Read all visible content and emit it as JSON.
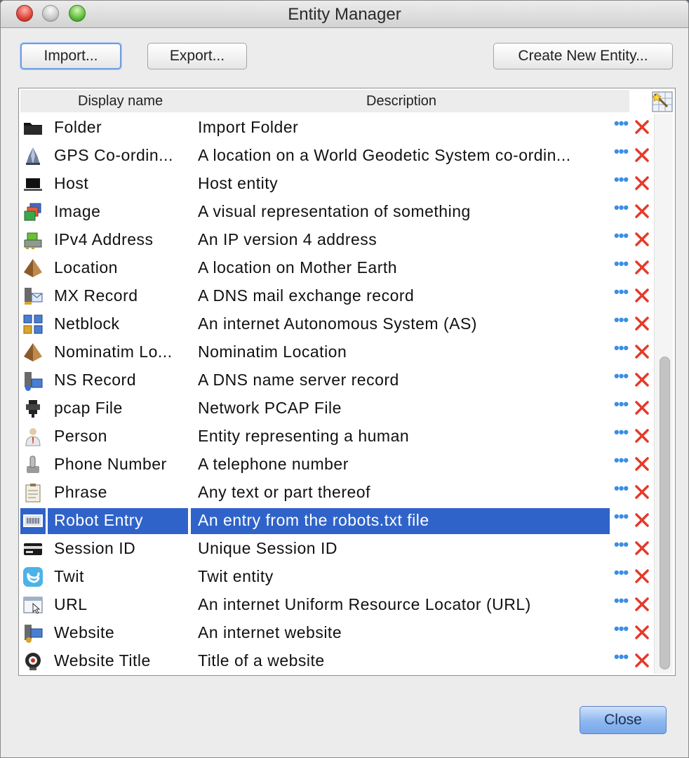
{
  "window": {
    "title": "Entity Manager"
  },
  "toolbar": {
    "import_label": "Import...",
    "export_label": "Export...",
    "create_label": "Create New Entity..."
  },
  "table": {
    "columns": [
      "Display name",
      "Description"
    ],
    "selected_row": "Robot Entry",
    "rows": [
      {
        "name": "Folder",
        "description": "Import Folder",
        "icon": "folder-icon"
      },
      {
        "name": "GPS Co-ordin...",
        "description": "A location on a World Geodetic System co-ordin...",
        "icon": "gps-icon"
      },
      {
        "name": "Host",
        "description": "Host entity",
        "icon": "laptop-icon"
      },
      {
        "name": "Image",
        "description": "A visual representation of something",
        "icon": "image-icon"
      },
      {
        "name": "IPv4 Address",
        "description": "An IP version 4 address",
        "icon": "network-card-icon"
      },
      {
        "name": "Location",
        "description": "A location on Mother Earth",
        "icon": "pyramid-icon"
      },
      {
        "name": "MX Record",
        "description": "A DNS mail exchange record",
        "icon": "mail-server-icon"
      },
      {
        "name": "Netblock",
        "description": "An internet Autonomous System (AS)",
        "icon": "netblock-icon"
      },
      {
        "name": "Nominatim Lo...",
        "description": "Nominatim Location",
        "icon": "pyramid-icon"
      },
      {
        "name": "NS Record",
        "description": "A DNS name server record",
        "icon": "name-server-icon"
      },
      {
        "name": "pcap File",
        "description": "Network PCAP File",
        "icon": "pcap-icon"
      },
      {
        "name": "Person",
        "description": "Entity representing a human",
        "icon": "person-icon"
      },
      {
        "name": "Phone Number",
        "description": "A telephone number",
        "icon": "phone-icon"
      },
      {
        "name": "Phrase",
        "description": "Any text or part thereof",
        "icon": "clipboard-icon"
      },
      {
        "name": "Robot Entry",
        "description": "An entry from the robots.txt file",
        "icon": "robot-entry-icon"
      },
      {
        "name": "Session ID",
        "description": "Unique Session ID",
        "icon": "card-icon"
      },
      {
        "name": "Twit",
        "description": "Twit entity",
        "icon": "twitter-icon"
      },
      {
        "name": "URL",
        "description": "An internet Uniform Resource Locator (URL)",
        "icon": "url-icon"
      },
      {
        "name": "Website",
        "description": "An internet website",
        "icon": "website-icon"
      },
      {
        "name": "Website Title",
        "description": "Title of a website",
        "icon": "website-title-icon"
      }
    ]
  },
  "footer": {
    "close_label": "Close"
  },
  "colors": {
    "selection": "#2f63c9",
    "delete": "#e53a2a",
    "more": "#3a8ee6"
  }
}
